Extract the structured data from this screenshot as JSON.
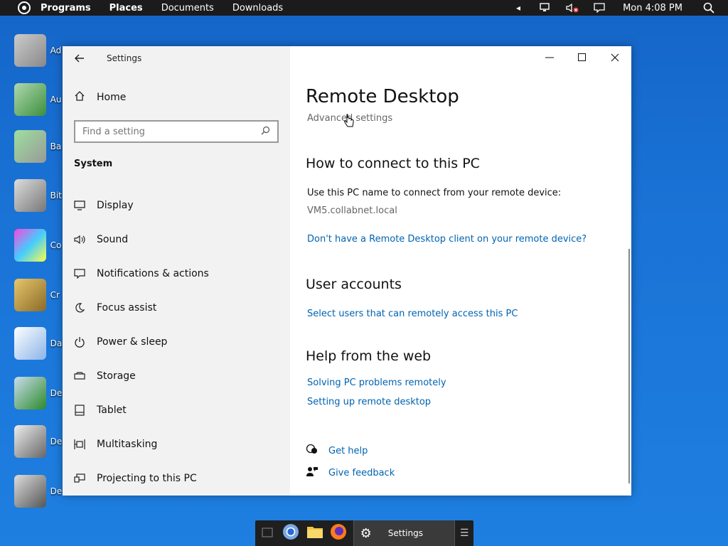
{
  "topbar": {
    "menus": [
      "Programs",
      "Places",
      "Documents",
      "Downloads"
    ],
    "clock": "Mon 4:08 PM"
  },
  "desktop": {
    "icons": [
      {
        "label": "Ad",
        "icon": "admin-tools-icon"
      },
      {
        "label": "Au",
        "icon": "autoplay-icon"
      },
      {
        "label": "Ba (W",
        "icon": "backup-icon"
      },
      {
        "label": "Bit En",
        "icon": "bitlocker-icon"
      },
      {
        "label": "Co",
        "icon": "color-management-icon"
      },
      {
        "label": "Cr",
        "icon": "credential-manager-icon"
      },
      {
        "label": "Da",
        "icon": "date-time-icon"
      },
      {
        "label": "De",
        "icon": "default-programs-icon"
      },
      {
        "label": "De",
        "icon": "device-manager-icon"
      },
      {
        "label": "De",
        "icon": "devices-printers-icon"
      }
    ]
  },
  "window": {
    "title": "Settings",
    "sidebar": {
      "home": "Home",
      "search_placeholder": "Find a setting",
      "section": "System",
      "items": [
        {
          "label": "Display",
          "icon": "display-icon"
        },
        {
          "label": "Sound",
          "icon": "sound-icon"
        },
        {
          "label": "Notifications & actions",
          "icon": "notifications-icon"
        },
        {
          "label": "Focus assist",
          "icon": "moon-icon"
        },
        {
          "label": "Power & sleep",
          "icon": "power-icon"
        },
        {
          "label": "Storage",
          "icon": "storage-icon"
        },
        {
          "label": "Tablet",
          "icon": "tablet-icon"
        },
        {
          "label": "Multitasking",
          "icon": "multitasking-icon"
        },
        {
          "label": "Projecting to this PC",
          "icon": "projecting-icon"
        }
      ]
    },
    "content": {
      "title": "Remote Desktop",
      "advanced": "Advanced settings",
      "connect_heading": "How to connect to this PC",
      "connect_text": "Use this PC name to connect from your remote device:",
      "pc_name": "VM5.collabnet.local",
      "client_link": "Don't have a Remote Desktop client on your remote device?",
      "accounts_heading": "User accounts",
      "accounts_link": "Select users that can remotely access this PC",
      "web_heading": "Help from the web",
      "web_link1": "Solving PC problems remotely",
      "web_link2": "Setting up remote desktop",
      "get_help": "Get help",
      "give_feedback": "Give feedback"
    }
  },
  "taskbar": {
    "active_label": "Settings"
  },
  "colors": {
    "link": "#0063b1",
    "sidebar_bg": "#f2f2f2",
    "desktop": "#1a73d6"
  }
}
